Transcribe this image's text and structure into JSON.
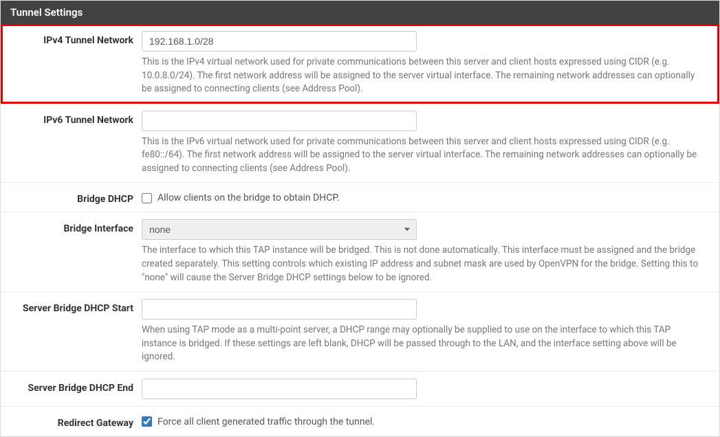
{
  "panel": {
    "title": "Tunnel Settings"
  },
  "fields": {
    "ipv4": {
      "label": "IPv4 Tunnel Network",
      "value": "192.168.1.0/28",
      "help": "This is the IPv4 virtual network used for private communications between this server and client hosts expressed using CIDR (e.g. 10.0.8.0/24). The first network address will be assigned to the server virtual interface. The remaining network addresses can optionally be assigned to connecting clients (see Address Pool)."
    },
    "ipv6": {
      "label": "IPv6 Tunnel Network",
      "value": "",
      "help": "This is the IPv6 virtual network used for private communications between this server and client hosts expressed using CIDR (e.g. fe80::/64). The first network address will be assigned to the server virtual interface. The remaining network addresses can optionally be assigned to connecting clients (see Address Pool)."
    },
    "bridge_dhcp": {
      "label": "Bridge DHCP",
      "checkbox_label": "Allow clients on the bridge to obtain DHCP.",
      "checked": false
    },
    "bridge_interface": {
      "label": "Bridge Interface",
      "selected": "none",
      "help": "The interface to which this TAP instance will be bridged. This is not done automatically. This interface must be assigned and the bridge created separately. This setting controls which existing IP address and subnet mask are used by OpenVPN for the bridge. Setting this to \"none\" will cause the Server Bridge DHCP settings below to be ignored."
    },
    "bridge_dhcp_start": {
      "label": "Server Bridge DHCP Start",
      "value": "",
      "help": "When using TAP mode as a multi-point server, a DHCP range may optionally be supplied to use on the interface to which this TAP instance is bridged. If these settings are left blank, DHCP will be passed through to the LAN, and the interface setting above will be ignored."
    },
    "bridge_dhcp_end": {
      "label": "Server Bridge DHCP End",
      "value": ""
    },
    "redirect_gateway": {
      "label": "Redirect Gateway",
      "checkbox_label": "Force all client generated traffic through the tunnel.",
      "checked": true
    }
  }
}
